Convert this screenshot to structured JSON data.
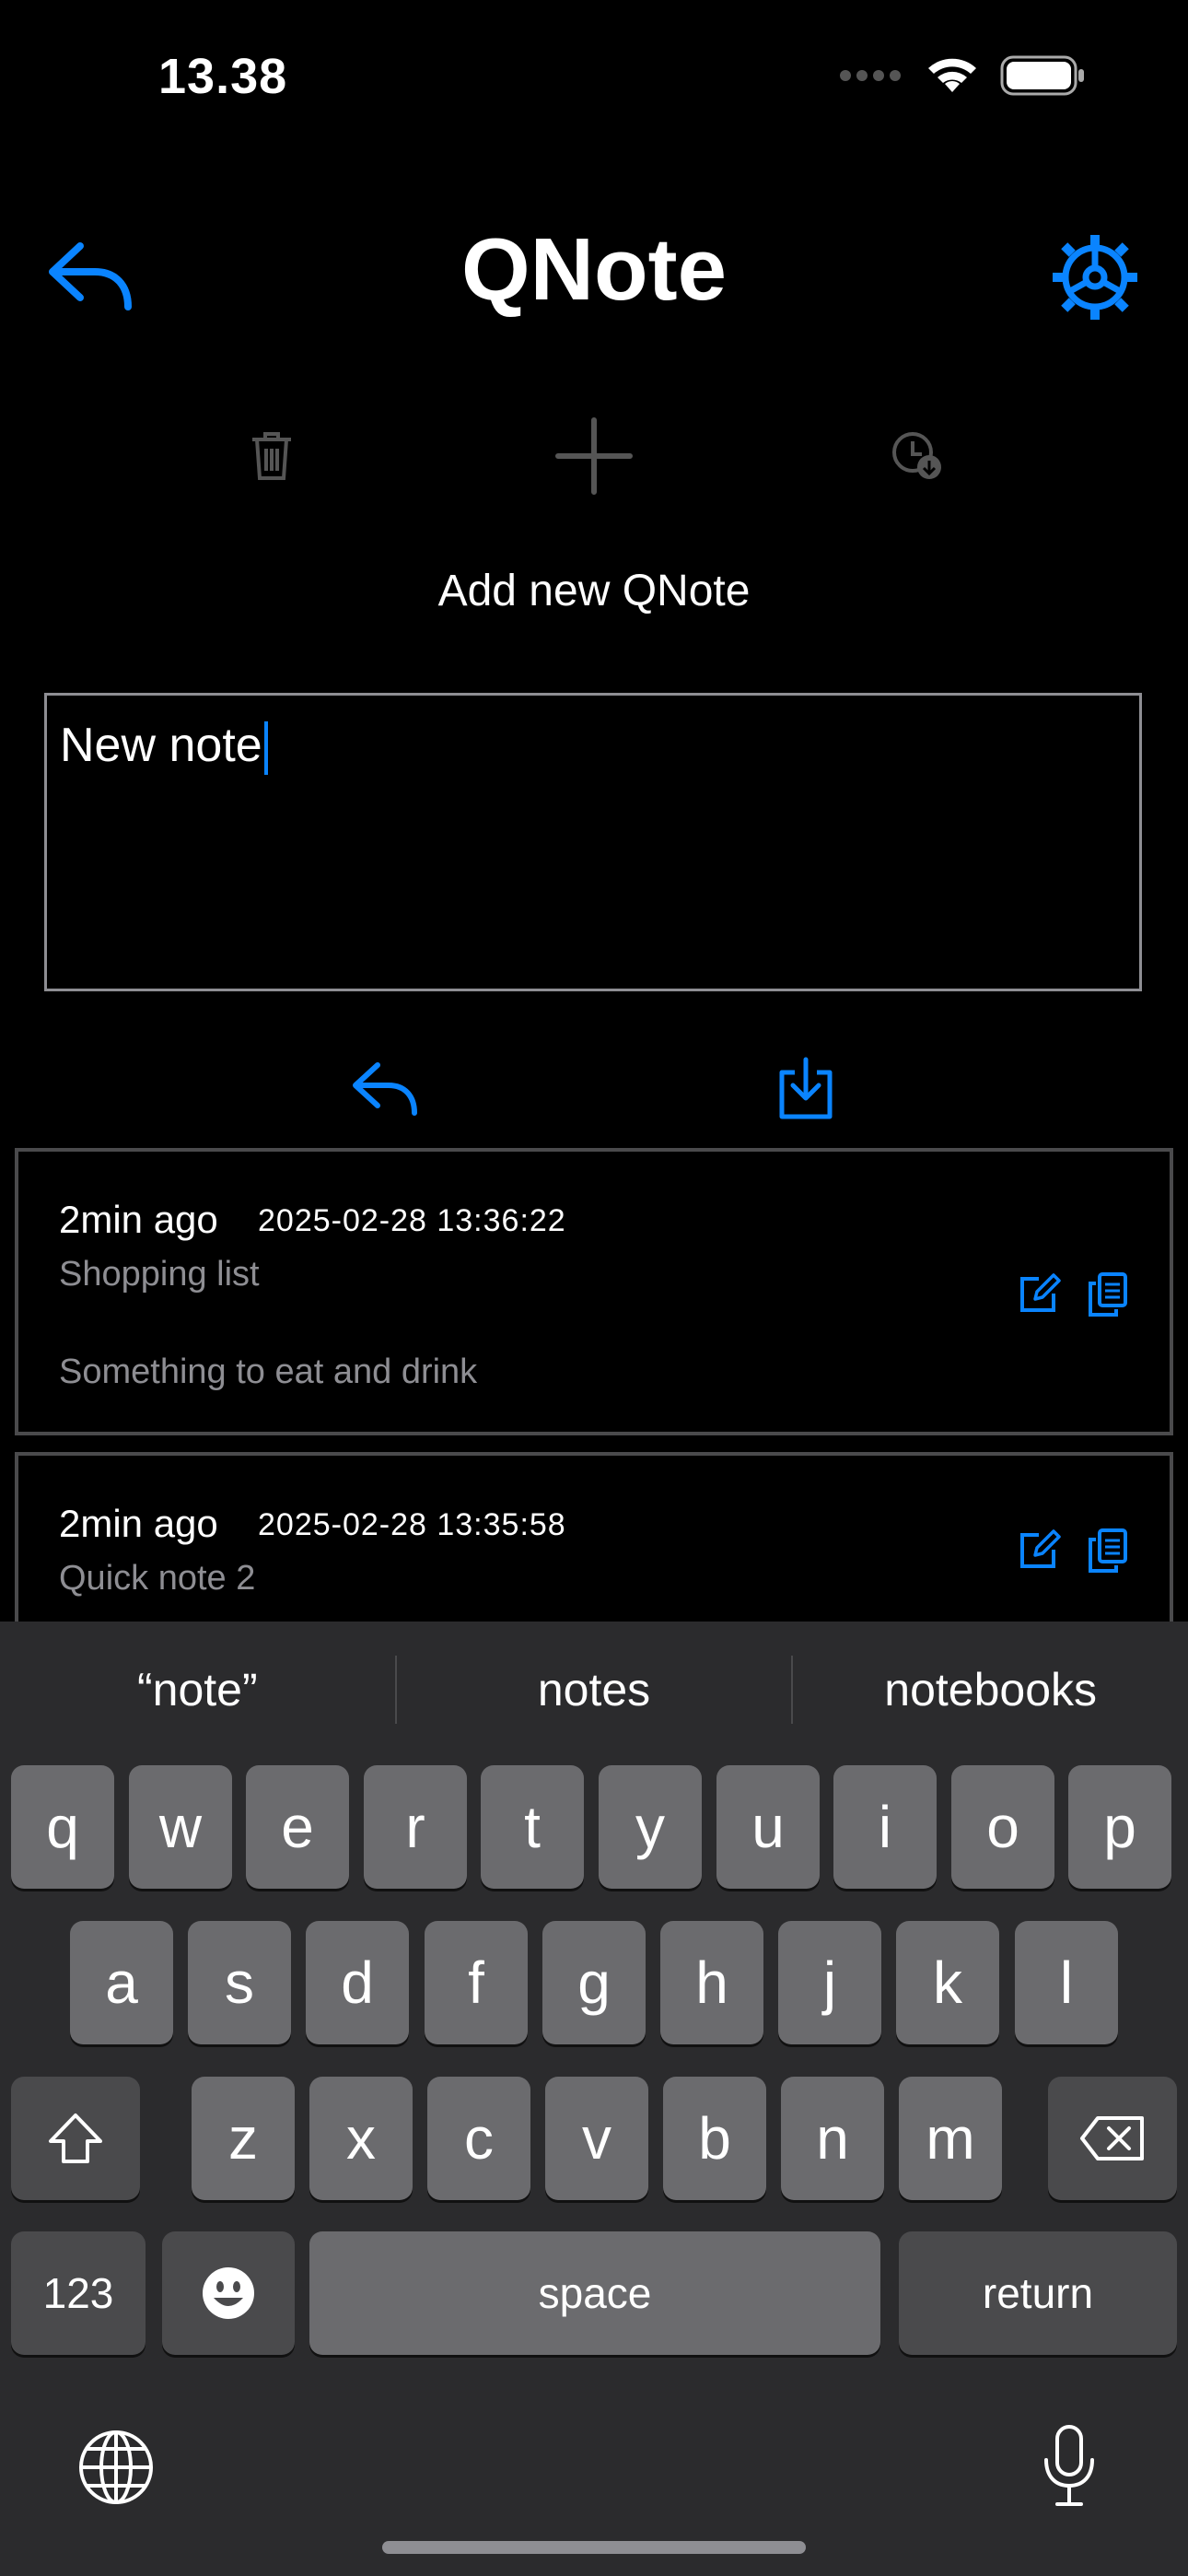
{
  "status": {
    "time": "13.38"
  },
  "header": {
    "title": "QNote",
    "back_icon": "undo-arrow-icon",
    "settings_icon": "gear-icon"
  },
  "toolbar": {
    "delete_icon": "trash-icon",
    "add_icon": "plus-icon",
    "history_icon": "clock-download-icon"
  },
  "subtitle": "Add new QNote",
  "editor": {
    "value": "New note"
  },
  "editor_actions": {
    "undo_icon": "undo-arrow-icon",
    "save_icon": "download-tray-icon"
  },
  "notes": [
    {
      "ago": "2min ago",
      "timestamp": "2025-02-28 13:36:22",
      "title": "Shopping list",
      "body": "Something to eat and drink"
    },
    {
      "ago": "2min ago",
      "timestamp": "2025-02-28 13:35:58",
      "title": "Quick note 2",
      "body": ""
    }
  ],
  "keyboard": {
    "suggestions": [
      "“note”",
      "notes",
      "notebooks"
    ],
    "row1": [
      "q",
      "w",
      "e",
      "r",
      "t",
      "y",
      "u",
      "i",
      "o",
      "p"
    ],
    "row2": [
      "a",
      "s",
      "d",
      "f",
      "g",
      "h",
      "j",
      "k",
      "l"
    ],
    "row3": [
      "z",
      "x",
      "c",
      "v",
      "b",
      "n",
      "m"
    ],
    "numbers_label": "123",
    "space_label": "space",
    "return_label": "return"
  },
  "colors": {
    "accent": "#0a84ff",
    "background": "#000000",
    "key": "#6b6b6e",
    "key_dark": "#4a4a4c"
  }
}
